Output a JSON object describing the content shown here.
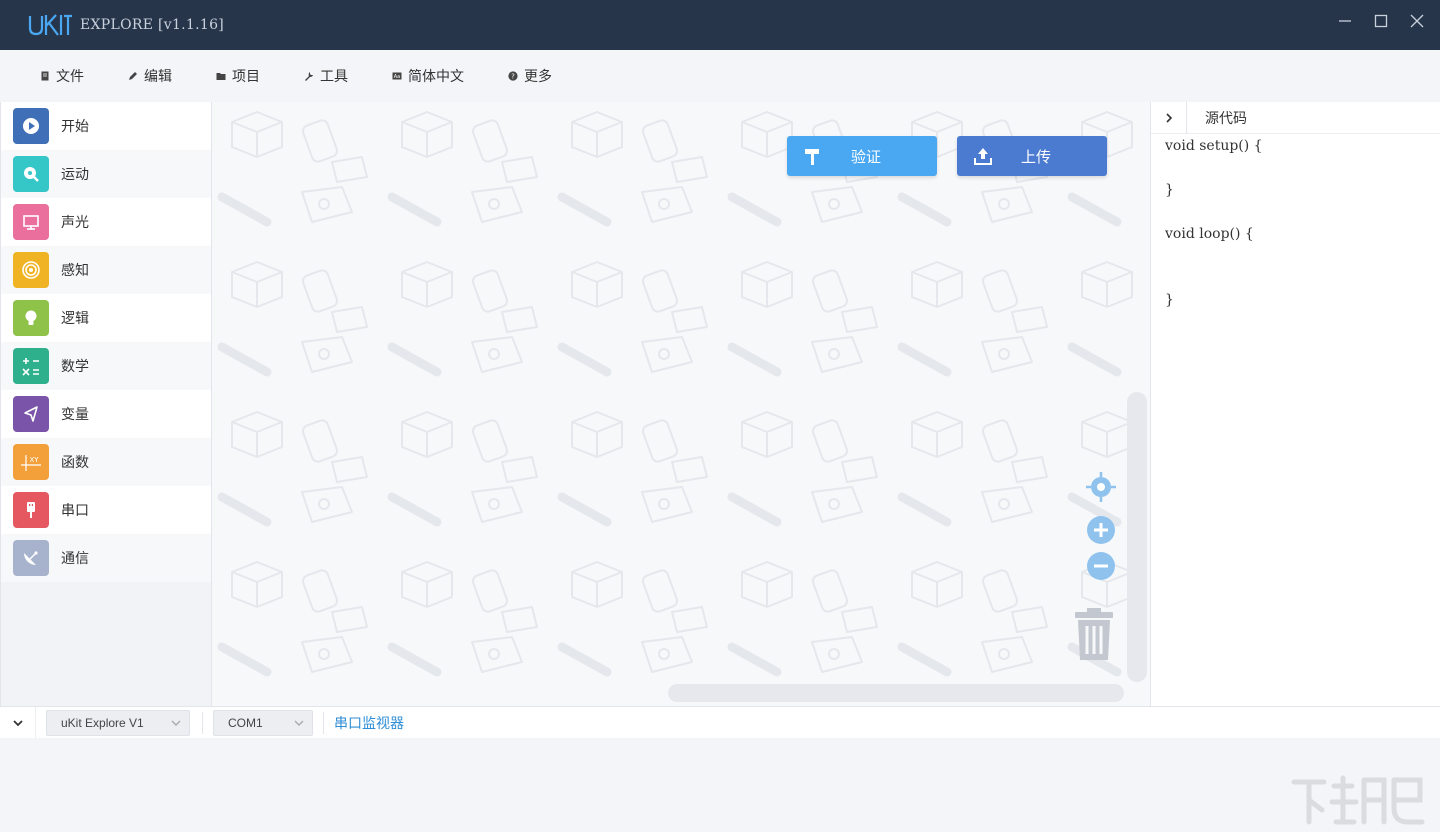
{
  "app": {
    "title": "EXPLORE [v1.1.16]",
    "logo_text": "uKIT"
  },
  "window_controls": {
    "minimize": "minimize",
    "maximize": "maximize",
    "close": "close"
  },
  "menu": {
    "items": [
      {
        "label": "文件",
        "icon": "file-icon"
      },
      {
        "label": "编辑",
        "icon": "edit-icon"
      },
      {
        "label": "项目",
        "icon": "folder-icon"
      },
      {
        "label": "工具",
        "icon": "wrench-icon"
      },
      {
        "label": "简体中文",
        "icon": "language-icon"
      },
      {
        "label": "更多",
        "icon": "help-icon"
      }
    ]
  },
  "sidebar": {
    "categories": [
      {
        "label": "开始",
        "color": "#3f6fb6",
        "icon": "play-icon"
      },
      {
        "label": "运动",
        "color": "#35c6c8",
        "icon": "motion-icon"
      },
      {
        "label": "声光",
        "color": "#ea6f9d",
        "icon": "monitor-icon"
      },
      {
        "label": "感知",
        "color": "#f0b323",
        "icon": "sensor-icon"
      },
      {
        "label": "逻辑",
        "color": "#8fc249",
        "icon": "bulb-icon"
      },
      {
        "label": "数学",
        "color": "#2fb08c",
        "icon": "math-icon"
      },
      {
        "label": "变量",
        "color": "#7a54a8",
        "icon": "variable-icon"
      },
      {
        "label": "函数",
        "color": "#f3a03b",
        "icon": "function-icon"
      },
      {
        "label": "串口",
        "color": "#e5585f",
        "icon": "usb-icon"
      },
      {
        "label": "通信",
        "color": "#a7b2cc",
        "icon": "satellite-icon"
      }
    ]
  },
  "workspace": {
    "verify_label": "验证",
    "upload_label": "上传",
    "verify_color": "#4aa8f2",
    "upload_color": "#4b7bd0"
  },
  "code_panel": {
    "title": "源代码",
    "lines": [
      "void setup() {",
      "",
      "}",
      "",
      "void loop() {",
      "",
      "",
      "",
      "}"
    ]
  },
  "bottom": {
    "board": "uKit Explore V1",
    "port": "COM1",
    "serial_monitor": "串口监视器"
  }
}
